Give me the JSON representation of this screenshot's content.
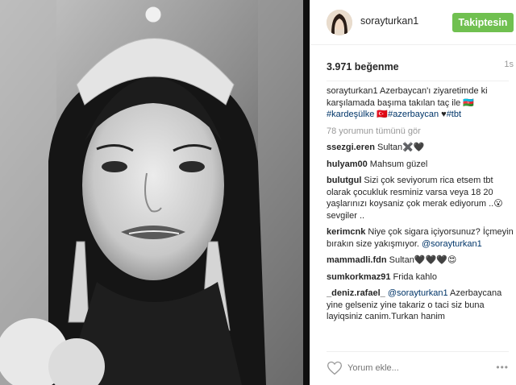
{
  "post": {
    "username": "sorayturkan1",
    "follow_label": "Takiptesin",
    "likes": "3.971 beğenme",
    "time": "1s",
    "caption_author": "sorayturkan1",
    "caption_text": " Azerbaycan'ı ziyaretimde ki karşılamada başıma takılan taç ile ",
    "caption_emoji_1": "🇦🇿",
    "caption_tag_1": "#kardeşülke",
    "caption_emoji_2": "🇹🇷",
    "caption_tag_2": "#azerbaycan",
    "caption_emoji_3": "♥",
    "caption_tag_3": "#tbt",
    "more_comments": "78 yorumun tümünü gör"
  },
  "comments": [
    {
      "author": "ssezgi.eren",
      "text": " Sultan✖️🖤"
    },
    {
      "author": "hulyam00",
      "text": " Mahsum güzel"
    },
    {
      "author": "bulutgul",
      "text": " Sizi çok seviyorum rica etsem tbt olarak çocukluk resminiz varsa veya 18 20 yaşlarınızı koysaniz çok merak ediyorum ..😮 sevgiler .."
    },
    {
      "author": "kerimcnk",
      "text": " Niye çok sigara içiyorsunuz? İçmeyin bırakın size yakışmıyor.",
      "mention": "@sorayturkan1"
    },
    {
      "author": "mammadli.fdn",
      "text": " Sultan🖤🖤🖤😍"
    },
    {
      "author": "sumkorkmaz91",
      "text": " Frida kahlo"
    },
    {
      "author": "_deniz.rafael_",
      "mention": "@sorayturkan1",
      "text": " Azerbaycana yine gelseniz yine takariz o taci siz buna layiqsiniz canim.Turkan hanim"
    }
  ],
  "footer": {
    "placeholder": "Yorum ekle...",
    "more_icon": "ellipsis-icon",
    "like_icon": "heart-outline-icon"
  },
  "colors": {
    "follow_button": "#70c050",
    "hashtag": "#003569",
    "muted": "#999999"
  }
}
